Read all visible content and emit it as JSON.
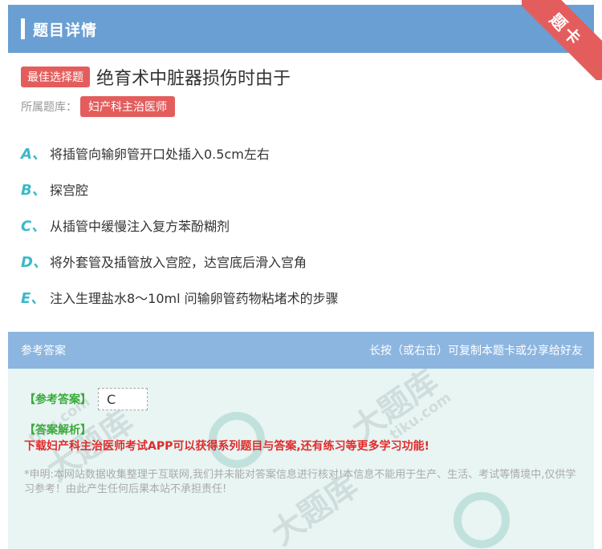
{
  "header": {
    "title": "题目详情",
    "ribbon": "题卡"
  },
  "question": {
    "type_badge": "最佳选择题",
    "title": "绝育术中脏器损伤时由于",
    "bank_label": "所属题库：",
    "bank_name": "妇产科主治医师"
  },
  "options": [
    {
      "letter": "A、",
      "text": "将插管向输卵管开口处插入0.5cm左右"
    },
    {
      "letter": "B、",
      "text": "探宫腔"
    },
    {
      "letter": "C、",
      "text": "从插管中缓慢注入复方苯酚糊剂"
    },
    {
      "letter": "D、",
      "text": "将外套管及插管放入宫腔，达宫底后滑入宫角"
    },
    {
      "letter": "E、",
      "text": "注入生理盐水8～10ml 问输卵管药物粘堵术的步骤"
    }
  ],
  "answer": {
    "bar_left": "参考答案",
    "bar_right": "长按（或右击）可复制本题卡或分享给好友",
    "answer_label": "【参考答案】",
    "answer_value": "C",
    "analysis_label": "【答案解析】",
    "promo": "下载妇产科主治医师考试APP可以获得系列题目与答案,还有练习等更多学习功能!",
    "disclaimer": "*申明:本网站数据收集整理于互联网,我们并未能对答案信息进行核对!本信息不能用于生产、生活、考试等情境中,仅供学习参考！由此产生任何后果本站不承担责任!"
  },
  "watermarks": [
    "tiku.com",
    "大题库"
  ]
}
